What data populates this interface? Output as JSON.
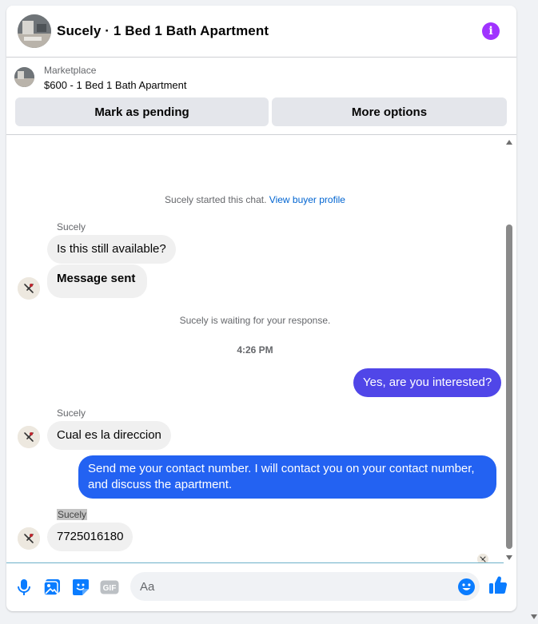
{
  "header": {
    "title": "Sucely · 1 Bed 1 Bath Apartment",
    "info_icon": "info-icon",
    "accent_color": "#a033ff"
  },
  "listing": {
    "source": "Marketplace",
    "title": "$600 - 1 Bed 1 Bath Apartment",
    "pending_label": "Mark as pending",
    "more_label": "More options"
  },
  "chat": {
    "started_text": "Sucely started this chat.",
    "buyer_profile_link": "View buyer profile",
    "waiting_text": "Sucely is waiting for your response.",
    "timestamp": "4:26 PM",
    "messages": [
      {
        "from": "Sucely",
        "sender_label": "Sucely",
        "text": "Is this still available?"
      },
      {
        "from": "Sucely",
        "text": "Message sent"
      },
      {
        "from": "me",
        "text": "Yes, are you interested?"
      },
      {
        "from": "Sucely",
        "sender_label": "Sucely",
        "text": "Cual es la direccion"
      },
      {
        "from": "me",
        "text": "Send me your contact number. I will contact you on your contact number, and discuss the apartment."
      },
      {
        "from": "Sucely",
        "sender_label": "Sucely",
        "text": "7725016180"
      }
    ]
  },
  "composer": {
    "placeholder": "Aa",
    "icons": [
      "microphone-icon",
      "photo-icon",
      "sticker-icon",
      "gif-icon",
      "emoji-icon",
      "like-icon"
    ],
    "gif_label": "GIF",
    "brand_color": "#0a7cff"
  }
}
